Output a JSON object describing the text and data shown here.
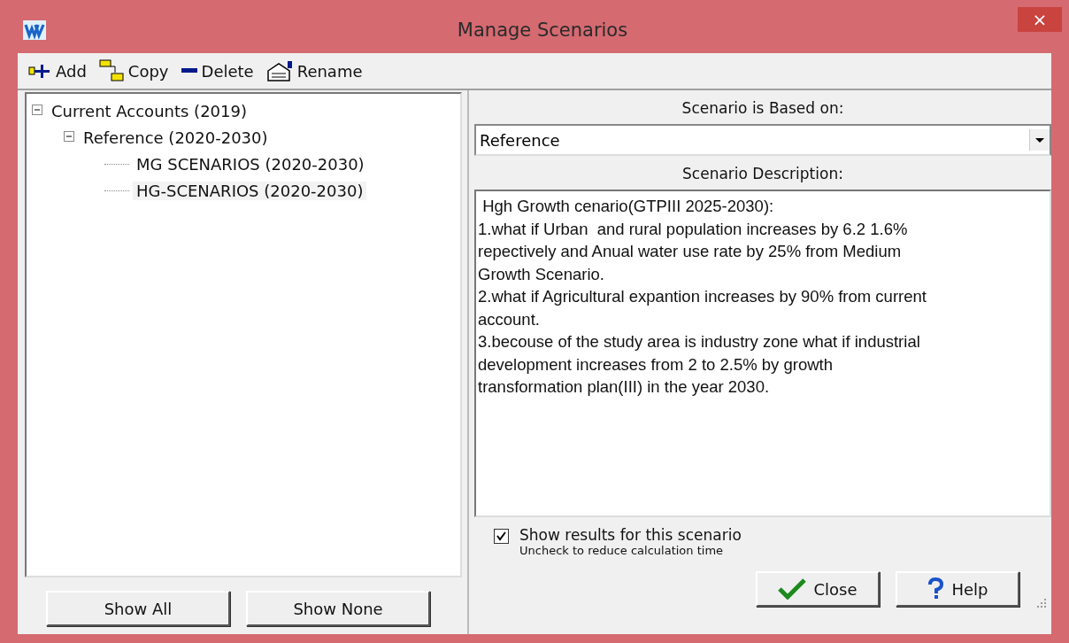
{
  "window": {
    "title": "Manage Scenarios",
    "close": "×"
  },
  "toolbar": [
    {
      "kind": "add",
      "label": "Add"
    },
    {
      "kind": "copy",
      "label": "Copy"
    },
    {
      "kind": "delete",
      "label": "Delete"
    },
    {
      "kind": "rename",
      "label": "Rename"
    }
  ],
  "tree": [
    {
      "label": "Current Accounts (2019)",
      "expanded": true,
      "selected": false,
      "children": [
        {
          "label": "Reference (2020-2030)",
          "expanded": true,
          "selected": false,
          "children": [
            {
              "label": "MG SCENARIOS (2020-2030)",
              "selected": false
            },
            {
              "label": "HG-SCENARIOS (2020-2030)",
              "selected": true
            }
          ]
        }
      ]
    }
  ],
  "based_on": {
    "label": "Scenario is Based on:",
    "value": "Reference"
  },
  "description": {
    "label": "Scenario Description:",
    "lines": [
      " Hgh Growth cenario(GTPIII 2025-2030):",
      "1.what if Urban  and rural population increases by 6.2 1.6%",
      "repectively and Anual water use rate by 25% from Medium",
      "Growth Scenario.",
      "2.what if Agricultural expantion increases by 90% from current",
      "account.",
      "3.becouse of the study area is industry zone what if industrial",
      "development increases from 2 to 2.5% by growth",
      "transformation plan(III) in the year 2030."
    ]
  },
  "show_results": {
    "label": "Show results for this scenario",
    "hint": "Uncheck to reduce calculation time",
    "checked": true
  },
  "left_buttons": [
    "Show All",
    "Show None"
  ],
  "right_buttons": [
    {
      "kind": "close",
      "label": "Close"
    },
    {
      "kind": "help",
      "label": "Help"
    }
  ]
}
